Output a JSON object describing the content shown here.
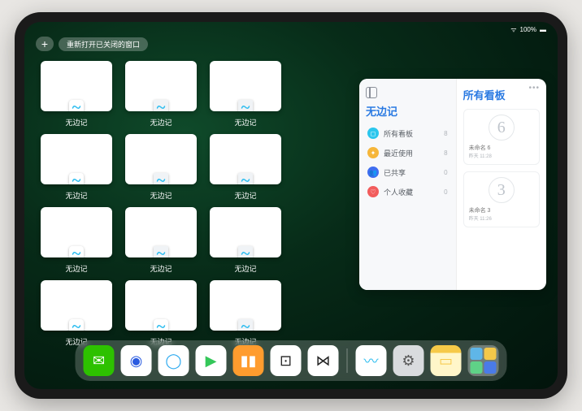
{
  "status": {
    "battery": "100%",
    "wifi": "●"
  },
  "top": {
    "reopen_label": "重新打开已关闭的窗口"
  },
  "app": {
    "name": "无边记",
    "badge_color": "#2fbef0"
  },
  "windows": {
    "rows": 4,
    "row_counts": [
      3,
      3,
      3,
      3
    ],
    "label": "无边记",
    "variants": [
      [
        "blank",
        "grid",
        "grid"
      ],
      [
        "blank",
        "grid",
        "grid"
      ],
      [
        "blank",
        "grid",
        "grid"
      ],
      [
        "blank",
        "blank",
        "grid"
      ]
    ]
  },
  "panel": {
    "left_title": "无边记",
    "items": [
      {
        "label": "所有看板",
        "count": 8,
        "color": "#2bc6ed",
        "icon": "◻"
      },
      {
        "label": "最近使用",
        "count": 8,
        "color": "#f6b63a",
        "icon": "✦"
      },
      {
        "label": "已共享",
        "count": 0,
        "color": "#3f6df0",
        "icon": "👥"
      },
      {
        "label": "个人收藏",
        "count": 0,
        "color": "#f25c5c",
        "icon": "♡"
      }
    ],
    "right_title": "所有看板",
    "boards": [
      {
        "glyph": "6",
        "title": "未命名 6",
        "meta": "昨天 11:28"
      },
      {
        "glyph": "3",
        "title": "未命名 3",
        "meta": "昨天 11:26"
      }
    ]
  },
  "dock": {
    "icons": [
      {
        "name": "wechat",
        "bg": "#2dc100",
        "glyph": "✉",
        "fg": "#fff"
      },
      {
        "name": "browser-1",
        "bg": "#ffffff",
        "glyph": "◉",
        "fg": "#2a5be0"
      },
      {
        "name": "browser-2",
        "bg": "#ffffff",
        "glyph": "◯",
        "fg": "#29a8ef"
      },
      {
        "name": "play",
        "bg": "#ffffff",
        "glyph": "▶",
        "fg": "#34c759"
      },
      {
        "name": "books",
        "bg": "#ff9c2e",
        "glyph": "▮▮",
        "fg": "#fff"
      },
      {
        "name": "dice",
        "bg": "#ffffff",
        "glyph": "⊡",
        "fg": "#222"
      },
      {
        "name": "network",
        "bg": "#ffffff",
        "glyph": "⋈",
        "fg": "#222"
      }
    ],
    "recent": [
      {
        "name": "freeform",
        "bg": "#ffffff",
        "glyph": "〰",
        "fg": "#2fbef0"
      },
      {
        "name": "settings",
        "bg": "#d9dbde",
        "glyph": "⚙",
        "fg": "#555"
      },
      {
        "name": "notes",
        "bg": "#fff6c9",
        "glyph": "▭",
        "fg": "#f6c948",
        "top": "#f6c948"
      }
    ]
  }
}
